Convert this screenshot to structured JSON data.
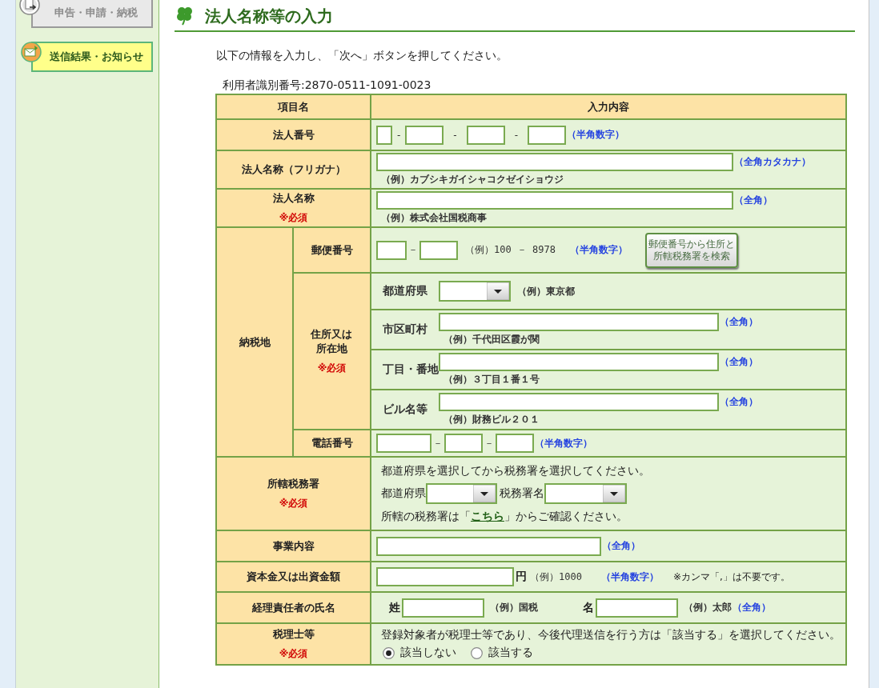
{
  "sidebar": {
    "items": [
      {
        "label": "申告・申請・納税",
        "selected": false
      },
      {
        "label": "送信結果・お知らせ",
        "selected": true
      }
    ]
  },
  "page": {
    "title": "法人名称等の入力",
    "instruction": "以下の情報を入力し、「次へ」ボタンを押してください。",
    "user_id": "利用者識別番号:2870-0511-1091-0023"
  },
  "form": {
    "columns": [
      "項目名",
      "入力内容"
    ],
    "rows": [
      {
        "kind": "corp_number",
        "label": "法人番号",
        "separators": [
          "-",
          "-",
          "-"
        ],
        "hint": "（半角数字）"
      },
      {
        "kind": "text",
        "label": "法人名称（フリガナ）",
        "hint": "（全角カタカナ）",
        "example": "（例）カブシキガイシャコクゼイショウジ"
      },
      {
        "kind": "text",
        "label": "法人名称",
        "required": "※必須",
        "hint": "（全角）",
        "example": "（例）株式会社国税商事"
      },
      {
        "kind": "group",
        "label": "納税地",
        "children": [
          {
            "kind": "postal",
            "label": "郵便番号",
            "separator": "－",
            "example": "（例）100 － 8978",
            "hint": "（半角数字）",
            "button": "郵便番号から住所と所轄税務署を検索"
          },
          {
            "kind": "address",
            "label": "住所又は所在地",
            "required": "※必須",
            "lines": [
              {
                "kind": "select",
                "label": "都道府県",
                "example": "（例）東京都"
              },
              {
                "kind": "input",
                "label": "市区町村",
                "hint": "（全角）",
                "example": "（例）千代田区霞が関"
              },
              {
                "kind": "input",
                "label": "丁目・番地",
                "hint": "（全角）",
                "example": "（例）３丁目１番１号"
              },
              {
                "kind": "input",
                "label": "ビル名等",
                "hint": "（全角）",
                "example": "（例）財務ビル２０１"
              }
            ]
          },
          {
            "kind": "phone",
            "label": "電話番号",
            "separators": [
              "－",
              "－"
            ],
            "hint": "（半角数字）"
          }
        ]
      },
      {
        "kind": "tax_office",
        "label": "所轄税務署",
        "required": "※必須",
        "instruction": "都道府県を選択してから税務署を選択してください。",
        "selects": [
          "都道府県",
          "税務署名"
        ],
        "note": {
          "before": "所轄の税務署は「",
          "link": "こちら",
          "after": "」からご確認ください。"
        }
      },
      {
        "kind": "short_text",
        "label": "事業内容",
        "hint": "（全角）"
      },
      {
        "kind": "amount",
        "label": "資本金又は出資金額",
        "unit": "円",
        "example": "（例）1000",
        "hint": "（半角数字）",
        "note": "※カンマ「,」は不要です。"
      },
      {
        "kind": "person_name",
        "label": "経理責任者の氏名",
        "parts": [
          {
            "label": "姓",
            "example": "（例）国税"
          },
          {
            "label": "名",
            "example": "（例）太郎"
          }
        ],
        "hint": "（全角）"
      },
      {
        "kind": "radio",
        "label": "税理士等",
        "required": "※必須",
        "instruction": "登録対象者が税理士等であり、今後代理送信を行う方は「該当する」を選択してください。",
        "options": [
          {
            "label": "該当しない",
            "selected": true
          },
          {
            "label": "該当する",
            "selected": false
          }
        ]
      }
    ]
  }
}
